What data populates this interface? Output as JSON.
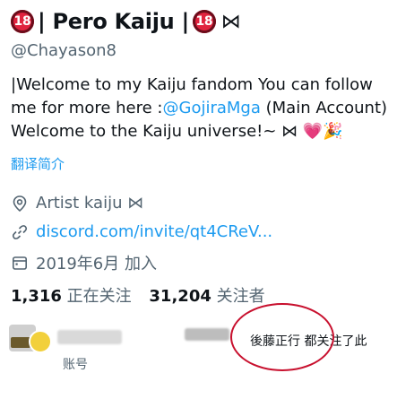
{
  "profile": {
    "badge_text": "18",
    "name": "| Pero Kaiju |",
    "bowtie": "⋈",
    "handle": "@Chayason8"
  },
  "bio": {
    "line1": "|Welcome to my Kaiju fandom  You can follow",
    "line2_prefix": "me for more here :",
    "line2_link": "@GojiraMga",
    "line2_suffix": "  (Main Account)",
    "line3": "Welcome to the Kaiju universe!~ ⋈ ",
    "line3_emojis": "💗🎉"
  },
  "translate_label": "翻译简介",
  "meta": {
    "location": "Artist kaiju ⋈",
    "link": "discord.com/invite/qt4CReV...",
    "joined": "2019年6月 加入"
  },
  "stats": {
    "following_count": "1,316",
    "following_label": "正在关注",
    "followers_count": "31,204",
    "followers_label": "关注者"
  },
  "followed_by": {
    "text": "後藤正行 都关注了此",
    "account_label": "账号"
  },
  "icons": {
    "location": "location-pin-icon",
    "link": "link-icon",
    "calendar": "calendar-icon"
  },
  "colors": {
    "link": "#1d9bf0",
    "secondary": "#536471",
    "annotation": "#c8102e"
  }
}
